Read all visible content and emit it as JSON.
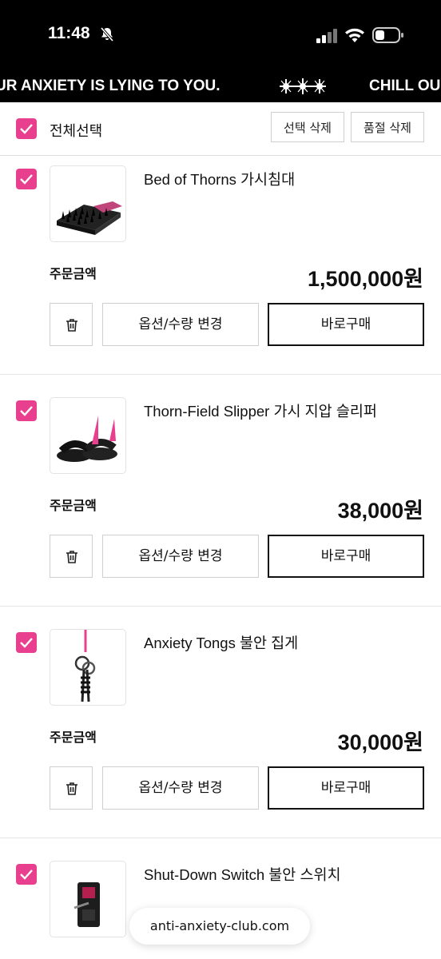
{
  "status_bar": {
    "time": "11:48"
  },
  "marquee": {
    "left_text": "UR ANXIETY IS LYING TO YOU.",
    "right_text": "CHILL OU"
  },
  "select_bar": {
    "select_all_label": "전체선택",
    "delete_selected_label": "선택 삭제",
    "delete_soldout_label": "품절 삭제"
  },
  "items": [
    {
      "name": "Bed of Thorns 가시침대",
      "order_label": "주문금액",
      "price": "1,500,000원",
      "option_label": "옵션/수량 변경",
      "buy_label": "바로구매",
      "icon": "spike-bed-image"
    },
    {
      "name": "Thorn-Field Slipper 가시 지압 슬리퍼",
      "order_label": "주문금액",
      "price": "38,000원",
      "option_label": "옵션/수량 변경",
      "buy_label": "바로구매",
      "icon": "spike-slipper-image"
    },
    {
      "name": "Anxiety Tongs 불안 집게",
      "order_label": "주문금액",
      "price": "30,000원",
      "option_label": "옵션/수량 변경",
      "buy_label": "바로구매",
      "icon": "tongs-image"
    },
    {
      "name": "Shut-Down Switch 불안 스위치",
      "icon": "switch-image"
    }
  ],
  "url_bar": {
    "url": "anti-anxiety-club.com"
  },
  "colors": {
    "accent": "#e8408f",
    "bar_bg": "#000000"
  }
}
